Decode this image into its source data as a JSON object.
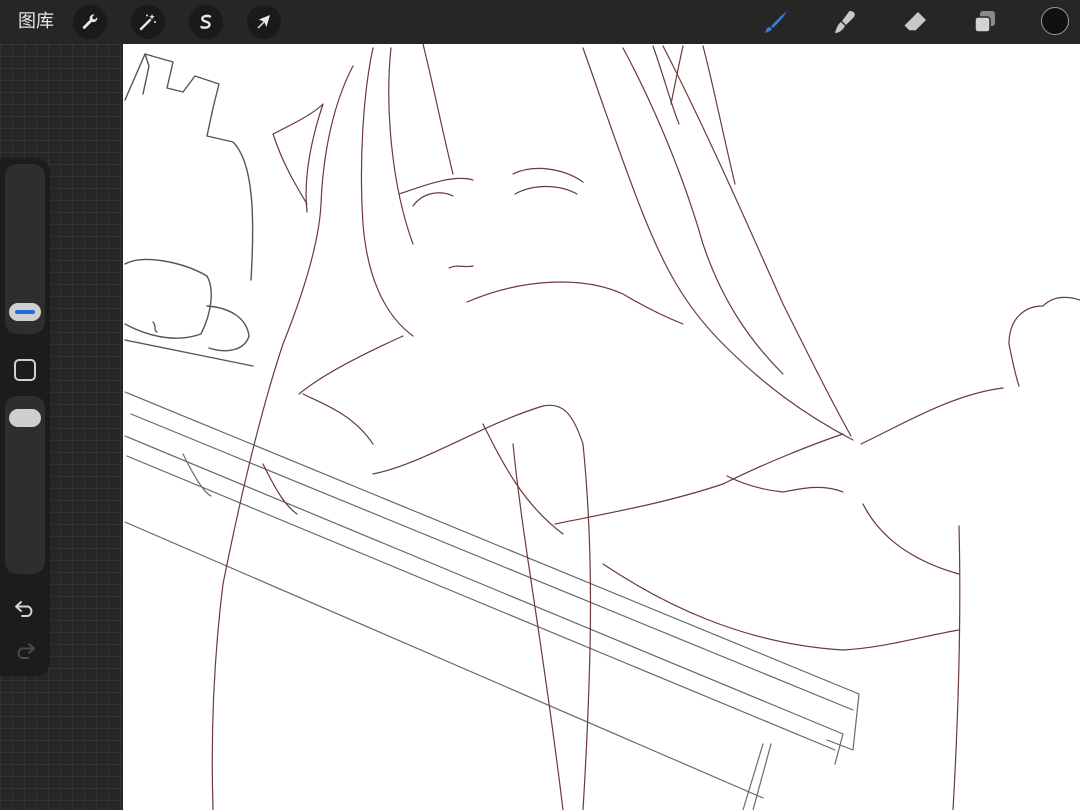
{
  "topbar": {
    "gallery_label": "图库",
    "left_tools": [
      {
        "name": "actions",
        "icon": "wrench-icon"
      },
      {
        "name": "adjustments",
        "icon": "magic-wand-icon"
      },
      {
        "name": "selection",
        "icon": "selection-s-icon"
      },
      {
        "name": "transform",
        "icon": "arrow-cursor-icon"
      }
    ],
    "right_tools": [
      {
        "name": "brush",
        "icon": "brush-icon",
        "active": true
      },
      {
        "name": "smudge",
        "icon": "smudge-icon"
      },
      {
        "name": "eraser",
        "icon": "eraser-icon"
      },
      {
        "name": "layers",
        "icon": "layers-icon"
      }
    ],
    "current_color": "#111111"
  },
  "sidebar": {
    "brush_size_level": 0.15,
    "opacity_level": 0.95,
    "icons": [
      "modify-square-icon",
      "undo-icon",
      "redo-icon"
    ]
  },
  "colors": {
    "accent": "#1e6fe0",
    "toolbar": "#262626",
    "sketch_brown": "#6b3a3a",
    "sketch_gray": "#555555"
  }
}
